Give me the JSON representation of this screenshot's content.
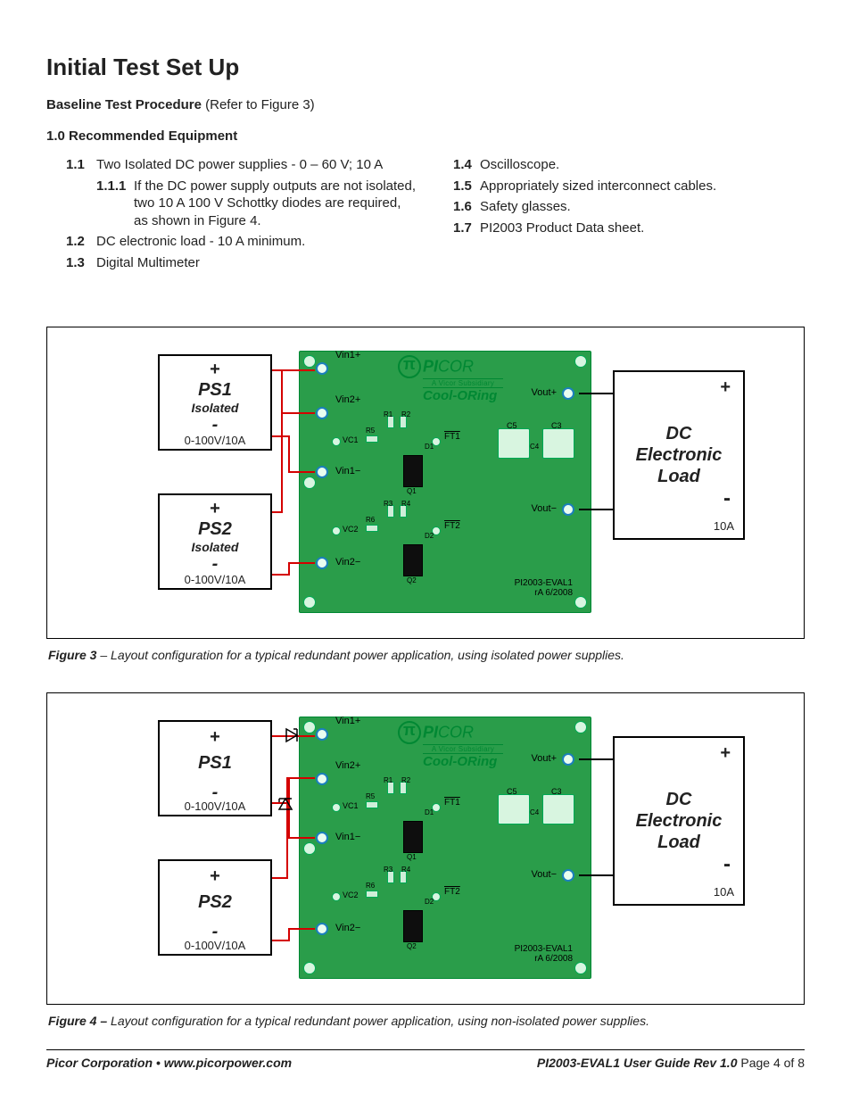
{
  "title": "Initial Test Set Up",
  "baseline_label": "Baseline Test Procedure",
  "baseline_refer": " (Refer to Figure 3)",
  "rec_equip": "1.0 Recommended Equipment",
  "left_items": [
    {
      "n": "1.1",
      "t": "Two Isolated DC power supplies - 0 – 60 V; 10 A"
    }
  ],
  "nested_item": {
    "n": "1.1.1",
    "t": "If the DC power supply outputs are not isolated, two 10 A 100 V Schottky diodes are required, as shown in Figure 4."
  },
  "left_items_2": [
    {
      "n": "1.2",
      "t": "DC electronic load - 10 A minimum."
    },
    {
      "n": "1.3",
      "t": "Digital Multimeter"
    }
  ],
  "right_items": [
    {
      "n": "1.4",
      "t": "Oscilloscope."
    },
    {
      "n": "1.5",
      "t": "Appropriately sized interconnect cables."
    },
    {
      "n": "1.6",
      "t": "Safety glasses."
    },
    {
      "n": "1.7",
      "t": "PI2003 Product Data sheet."
    }
  ],
  "diagram": {
    "ps1": "PS1",
    "ps2": "PS2",
    "isolated": "Isolated",
    "range": "0-100V/10A",
    "plus": "+",
    "minus": "-",
    "load_line1": "DC",
    "load_line2": "Electronic",
    "load_line3": "Load",
    "load_amp": "10A",
    "brand_p": "P",
    "brand_i": "I",
    "brand_cor": "COR",
    "vicor_sub": "A Vicor Subsidiary",
    "cool": "Cool-ORing",
    "vin1p": "Vin1+",
    "vin2p": "Vin2+",
    "vin1m": "Vin1−",
    "vin2m": "Vin2−",
    "voutp": "Vout+",
    "voutm": "Vout−",
    "ft1": "FT1",
    "ft2": "FT2",
    "vc1": "VC1",
    "vc2": "VC2",
    "r1": "R1",
    "r2": "R2",
    "r3": "R3",
    "r4": "R4",
    "r5": "R5",
    "r6": "R6",
    "c3": "C3",
    "c4": "C4",
    "c5": "C5",
    "d1": "D1",
    "d2": "D2",
    "q1": "Q1",
    "q2": "Q2",
    "rev_a": "PI2003-EVAL1",
    "rev_b": "rA 6/2008"
  },
  "fig3_bold": "Figure 3",
  "fig3_text": " – Layout configuration for a typical redundant power application, using isolated power supplies.",
  "fig4_bold": "Figure 4 –",
  "fig4_text": " Layout configuration for a typical redundant power application, using non-isolated power supplies.",
  "footer_left": "Picor Corporation • www.picorpower.com",
  "footer_right_bold": "PI2003-EVAL1 User Guide  Rev 1.0",
  "footer_page": "  Page 4 of 8"
}
